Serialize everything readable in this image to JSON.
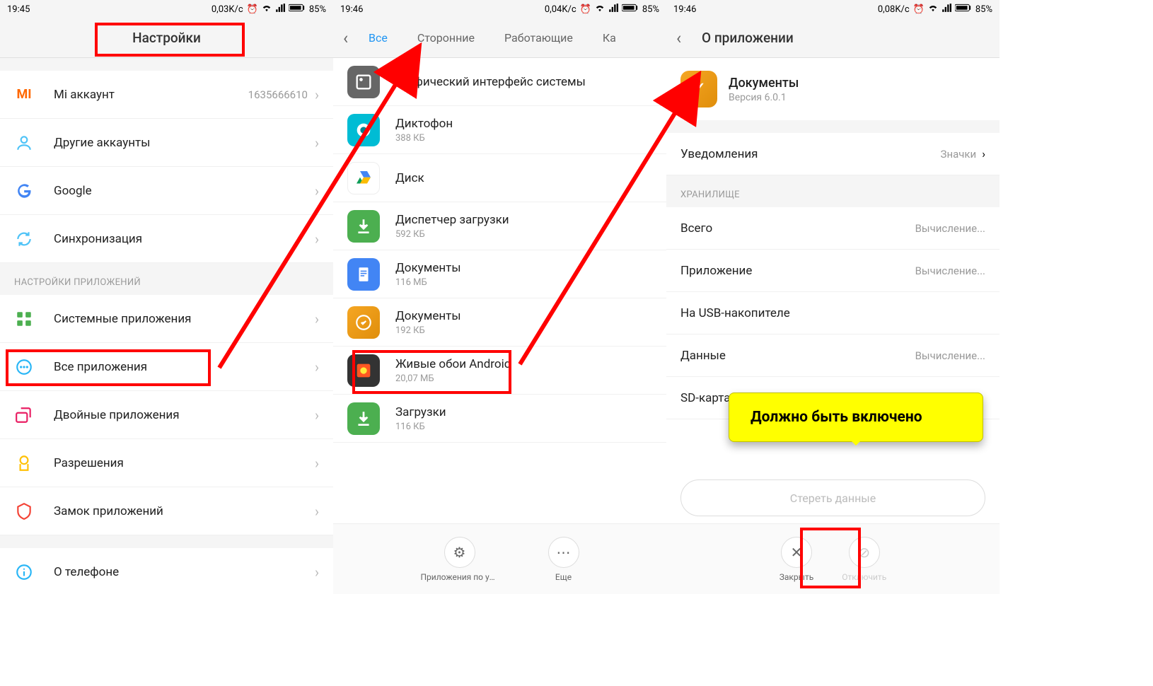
{
  "screen1": {
    "status": {
      "time": "19:45",
      "speed": "0,03K/c",
      "battery": "85%"
    },
    "title": "Настройки",
    "items": [
      {
        "icon": "mi",
        "label": "Mi аккаунт",
        "value": "1635666610"
      },
      {
        "icon": "user",
        "label": "Другие аккаунты",
        "value": ""
      },
      {
        "icon": "google",
        "label": "Google",
        "value": ""
      },
      {
        "icon": "sync",
        "label": "Синхронизация",
        "value": ""
      }
    ],
    "section": "НАСТРОЙКИ ПРИЛОЖЕНИЙ",
    "items2": [
      {
        "icon": "grid",
        "label": "Системные приложения"
      },
      {
        "icon": "dots",
        "label": "Все приложения"
      },
      {
        "icon": "dual",
        "label": "Двойные приложения"
      },
      {
        "icon": "perm",
        "label": "Разрешения"
      },
      {
        "icon": "lock",
        "label": "Замок приложений"
      },
      {
        "icon": "info",
        "label": "О телефоне"
      }
    ]
  },
  "screen2": {
    "status": {
      "time": "19:46",
      "speed": "0,04K/c",
      "battery": "85%"
    },
    "tabs": [
      "Все",
      "Сторонние",
      "Работающие",
      "Ка"
    ],
    "apps": [
      {
        "name": "Графический интерфейс системы",
        "size": "",
        "ico": "sysui"
      },
      {
        "name": "Диктофон",
        "size": "388 КБ",
        "ico": "rec"
      },
      {
        "name": "Диск",
        "size": "",
        "ico": "drive"
      },
      {
        "name": "Диспетчер загрузки",
        "size": "592 КБ",
        "ico": "dlmgr"
      },
      {
        "name": "Документы",
        "size": "116 МБ",
        "ico": "docs"
      },
      {
        "name": "Документы",
        "size": "192 КБ",
        "ico": "doc2"
      },
      {
        "name": "Живые обои Android",
        "size": "20,07 МБ",
        "ico": "live"
      },
      {
        "name": "Загрузки",
        "size": "116 КБ",
        "ico": "dl"
      }
    ],
    "actions": [
      {
        "label": "Приложения по умо...",
        "icon": "gear"
      },
      {
        "label": "Еще",
        "icon": "more"
      }
    ]
  },
  "screen3": {
    "status": {
      "time": "19:46",
      "speed": "0,08K/c",
      "battery": "85%"
    },
    "title": "О приложении",
    "app": {
      "name": "Документы",
      "version": "Версия 6.0.1"
    },
    "notif": {
      "label": "Уведомления",
      "value": "Значки"
    },
    "storage_hdr": "ХРАНИЛИЩЕ",
    "storage": [
      {
        "label": "Всего",
        "value": "Вычисление..."
      },
      {
        "label": "Приложение",
        "value": "Вычисление..."
      },
      {
        "label": "На USB-накопителе",
        "value": ""
      },
      {
        "label": "Данные",
        "value": "Вычисление..."
      },
      {
        "label": "SD-карта",
        "value": ""
      }
    ],
    "erase": "Стереть данные",
    "actions": [
      {
        "label": "Закрыть",
        "icon": "close"
      },
      {
        "label": "Отключить",
        "icon": "disable"
      }
    ]
  },
  "callout": "Должно быть включено"
}
